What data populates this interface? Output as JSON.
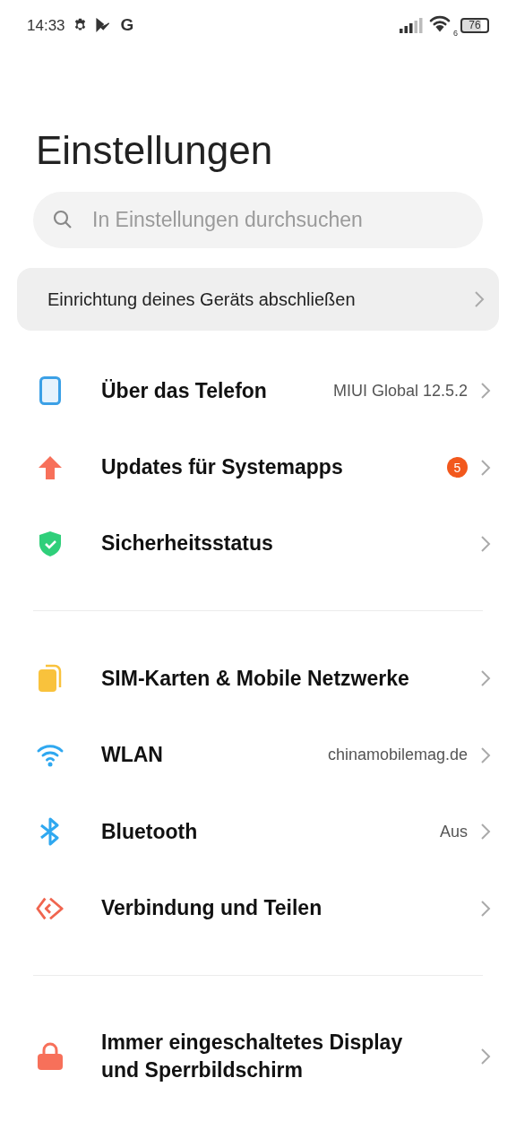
{
  "status_bar": {
    "time": "14:33",
    "network_letter": "G",
    "wifi_badge": "6",
    "battery": "76"
  },
  "title": "Einstellungen",
  "search": {
    "placeholder": "In Einstellungen durchsuchen"
  },
  "setup_card": {
    "label": "Einrichtung deines Geräts abschließen"
  },
  "sections": [
    {
      "items": [
        {
          "kind": "phone",
          "title": "Über das Telefon",
          "value": "MIUI Global 12.5.2"
        },
        {
          "kind": "update",
          "title": "Updates für Systemapps",
          "badge": "5"
        },
        {
          "kind": "shield",
          "title": "Sicherheitsstatus"
        }
      ]
    },
    {
      "items": [
        {
          "kind": "sim",
          "title": "SIM-Karten & Mobile Netzwerke"
        },
        {
          "kind": "wifi",
          "title": "WLAN",
          "value": "chinamobilemag.de"
        },
        {
          "kind": "bluetooth",
          "title": "Bluetooth",
          "value": "Aus"
        },
        {
          "kind": "share",
          "title": "Verbindung und Teilen"
        }
      ]
    },
    {
      "items": [
        {
          "kind": "lock",
          "title": "Immer eingeschaltetes Display und Sperrbildschirm"
        }
      ]
    }
  ]
}
